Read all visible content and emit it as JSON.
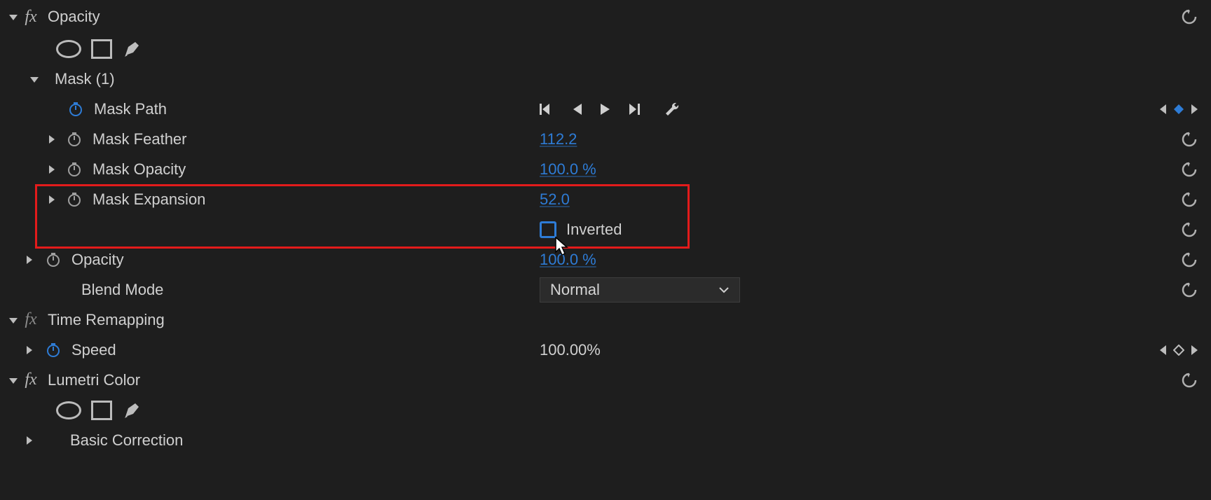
{
  "opacity": {
    "header": "Opacity",
    "mask": {
      "header": "Mask (1)",
      "path_label": "Mask Path",
      "feather_label": "Mask Feather",
      "feather_value": "112.2",
      "opacity_label": "Mask Opacity",
      "opacity_value": "100.0 %",
      "expansion_label": "Mask Expansion",
      "expansion_value": "52.0",
      "inverted_label": "Inverted"
    },
    "opacity_prop_label": "Opacity",
    "opacity_prop_value": "100.0 %",
    "blend_mode_label": "Blend Mode",
    "blend_mode_value": "Normal"
  },
  "time_remapping": {
    "header": "Time Remapping",
    "speed_label": "Speed",
    "speed_value": "100.00%"
  },
  "lumetri": {
    "header": "Lumetri Color",
    "basic_correction_label": "Basic Correction"
  }
}
